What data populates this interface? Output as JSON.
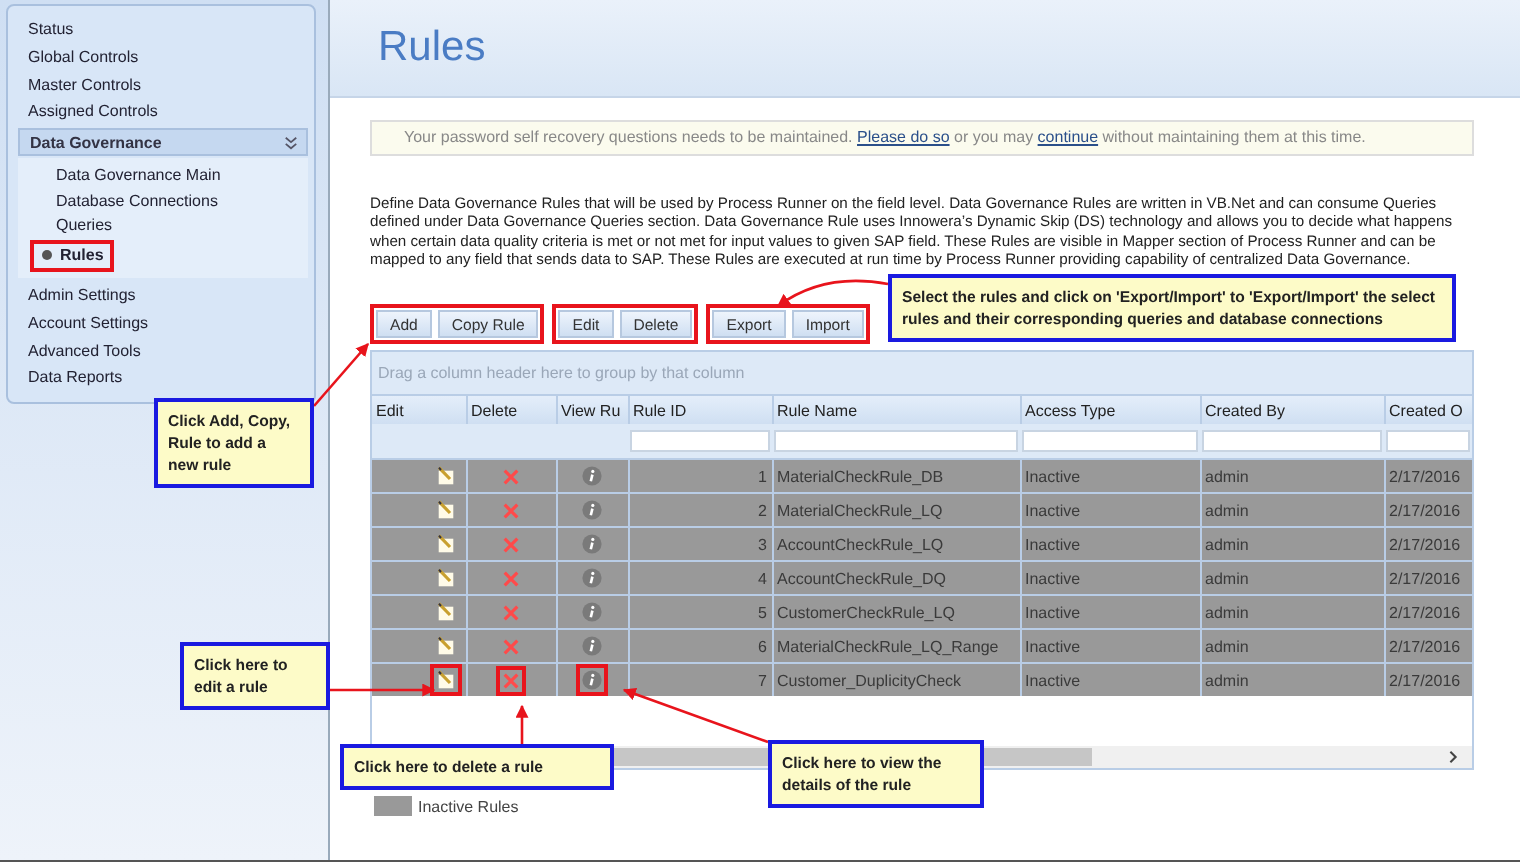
{
  "sidebar": {
    "items": [
      {
        "label": "Status",
        "selected": false
      },
      {
        "label": "Global Controls",
        "selected": false
      },
      {
        "label": "Master Controls",
        "selected": false
      },
      {
        "label": "Assigned Controls",
        "selected": false
      },
      {
        "label": "Data Governance",
        "selected": false,
        "expanded": true,
        "children": [
          {
            "label": "Data Governance Main",
            "selected": false,
            "highlighted": false
          },
          {
            "label": "Database Connections",
            "selected": false,
            "highlighted": false
          },
          {
            "label": "Queries",
            "selected": false,
            "highlighted": false
          },
          {
            "label": "Rules",
            "selected": true,
            "highlighted": true
          }
        ]
      },
      {
        "label": "Admin Settings",
        "selected": false
      },
      {
        "label": "Account Settings",
        "selected": false
      },
      {
        "label": "Advanced Tools",
        "selected": false
      },
      {
        "label": "Data Reports",
        "selected": false
      }
    ]
  },
  "page_title": "Rules",
  "notice": [
    {
      "kind": "text",
      "text": "Your password self recovery questions needs to be maintained. "
    },
    {
      "kind": "link",
      "text": "Please do so"
    },
    {
      "kind": "text",
      "text": " or you may "
    },
    {
      "kind": "link",
      "text": "continue"
    },
    {
      "kind": "text",
      "text": " without maintaining them at this time."
    }
  ],
  "description": "Define Data Governance Rules that will be used by Process Runner on the field level. Data Governance Rules are written in VB.Net and can consume Queries defined under Data Governance Queries section. Data Governance Rule uses Innowera’s Dynamic Skip (DS) technology and allows you to decide what happens when certain data quality criteria is met or not met for input values to given SAP field. These Rules are visible in Mapper section of Process Runner and can be mapped to any field that sends data to SAP. These Rules are executed at run time by Process Runner providing capability of centralized Data Governance.",
  "button_groups": [
    {
      "highlighted": true,
      "buttons": [
        "Add",
        "Copy Rule"
      ]
    },
    {
      "highlighted": true,
      "buttons": [
        "Edit",
        "Delete"
      ]
    },
    {
      "highlighted": true,
      "buttons": [
        "Export",
        "Import"
      ]
    }
  ],
  "grid": {
    "group_hint": "Drag a column header here to group by that column",
    "columns": [
      "Edit",
      "Delete",
      "View Ru",
      "Rule ID",
      "Rule Name",
      "Access Type",
      "Created By",
      "Created O"
    ],
    "rows": [
      {
        "rule_id": "1",
        "rule_name": "MaterialCheckRule_DB",
        "access_type": "Inactive",
        "created_by": "admin",
        "created_on": "2/17/2016",
        "inactive": true,
        "highlighted": false
      },
      {
        "rule_id": "2",
        "rule_name": "MaterialCheckRule_LQ",
        "access_type": "Inactive",
        "created_by": "admin",
        "created_on": "2/17/2016",
        "inactive": true,
        "highlighted": false
      },
      {
        "rule_id": "3",
        "rule_name": "AccountCheckRule_LQ",
        "access_type": "Inactive",
        "created_by": "admin",
        "created_on": "2/17/2016",
        "inactive": true,
        "highlighted": false
      },
      {
        "rule_id": "4",
        "rule_name": "AccountCheckRule_DQ",
        "access_type": "Inactive",
        "created_by": "admin",
        "created_on": "2/17/2016",
        "inactive": true,
        "highlighted": false
      },
      {
        "rule_id": "5",
        "rule_name": "CustomerCheckRule_LQ",
        "access_type": "Inactive",
        "created_by": "admin",
        "created_on": "2/17/2016",
        "inactive": true,
        "highlighted": false
      },
      {
        "rule_id": "6",
        "rule_name": "MaterialCheckRule_LQ_Range",
        "access_type": "Inactive",
        "created_by": "admin",
        "created_on": "2/17/2016",
        "inactive": true,
        "highlighted": false
      },
      {
        "rule_id": "7",
        "rule_name": "Customer_DuplicityCheck",
        "access_type": "Inactive",
        "created_by": "admin",
        "created_on": "2/17/2016",
        "inactive": true,
        "highlighted": true
      }
    ]
  },
  "legend": {
    "label": "Inactive Rules"
  },
  "callouts": [
    {
      "text": "Click Add, Copy, Rule to add a new rule"
    },
    {
      "text": "Select the rules and click on 'Export/Import' to 'Export/Import' the select rules and their corresponding queries and database connections"
    },
    {
      "text": "Click here to edit a rule"
    },
    {
      "text": "Click here to delete a rule"
    },
    {
      "text": "Click here to view the details of the rule"
    }
  ]
}
